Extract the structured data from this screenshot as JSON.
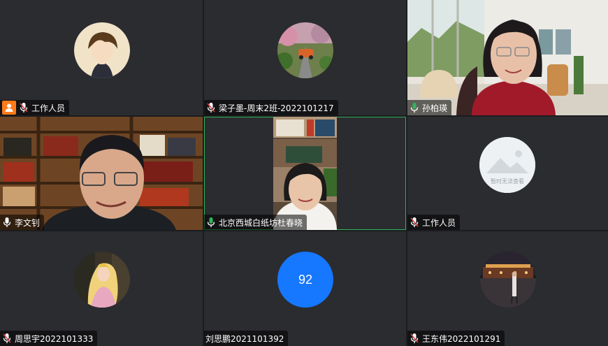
{
  "participants": [
    {
      "name": "工作人员",
      "tile": "tile-1",
      "avatar": "anime-boy-avatar",
      "mic": "muted",
      "staff": true
    },
    {
      "name": "梁子墨-周末2班-2022101217",
      "tile": "tile-2",
      "avatar": "car-street-avatar",
      "mic": "muted"
    },
    {
      "name": "孙柏瑛",
      "tile": "tile-3",
      "video": "woman-living-room-video",
      "mic": "active"
    },
    {
      "name": "李文钊",
      "tile": "tile-4",
      "video": "man-bookshelf-video",
      "mic": "active"
    },
    {
      "name": "北京西城白纸坊杜春晓",
      "tile": "tile-5",
      "video": "woman-bookshelf-video",
      "mic": "active",
      "speaking": true
    },
    {
      "name": "工作人员",
      "tile": "tile-6",
      "avatar": "image-unavailable-avatar",
      "avatar_text": "暂时无法查看",
      "mic": "muted"
    },
    {
      "name": "周思宇2022101333",
      "tile": "tile-7",
      "avatar": "princess-avatar",
      "mic": "muted"
    },
    {
      "name": "刘思鹏2021101392",
      "tile": "tile-8",
      "avatar_number": "92",
      "mic": "none"
    },
    {
      "name": "王东伟2022101291",
      "tile": "tile-9",
      "avatar": "night-palace-avatar",
      "mic": "muted"
    }
  ],
  "colors": {
    "tile_bg": "#2b2c30",
    "speaking_border": "#2fb55a",
    "number_avatar": "#1677ff",
    "staff_badge": "#ff7a1a",
    "mic_active": "#2fb55a",
    "mic_muted": "#e04040"
  }
}
